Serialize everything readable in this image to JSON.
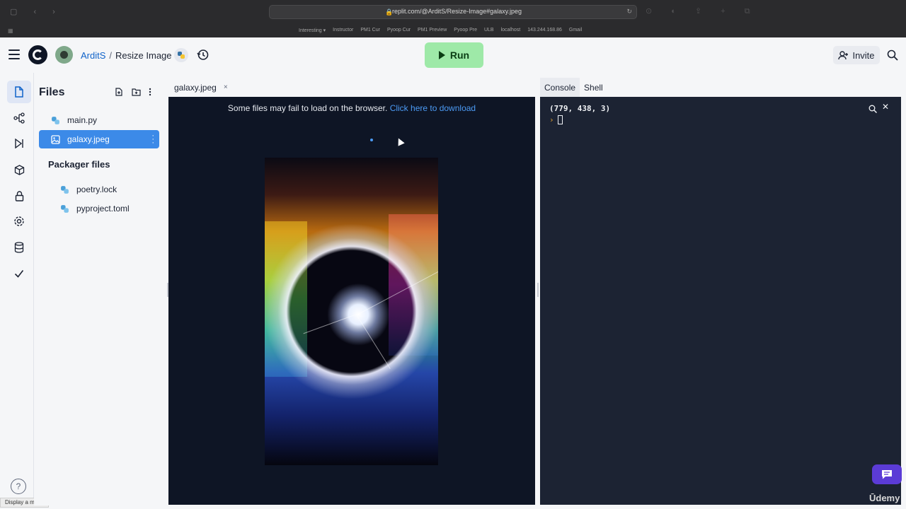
{
  "browser": {
    "url": "replit.com/@ArditS/Resize-Image#galaxy.jpeg",
    "bookmarks": [
      "Interesting ▾",
      "Instructor",
      "PM1 Cur",
      "Pyoop Cur",
      "PM1 Preview",
      "Pyoop Pre",
      "ULB",
      "localhost",
      "143.244.168.86",
      "Gmail"
    ]
  },
  "header": {
    "user": "ArditS",
    "separator": "/",
    "repl_name": "Resize Image",
    "run_label": "Run",
    "invite_label": "Invite"
  },
  "files_panel": {
    "title": "Files",
    "files": [
      {
        "name": "main.py",
        "icon": "python-icon"
      },
      {
        "name": "galaxy.jpeg",
        "icon": "image-icon",
        "selected": true
      }
    ],
    "packager_title": "Packager files",
    "packager_files": [
      {
        "name": "poetry.lock",
        "icon": "python-icon"
      },
      {
        "name": "pyproject.toml",
        "icon": "python-icon"
      }
    ]
  },
  "editor": {
    "tab_label": "galaxy.jpeg",
    "tab_close": "×",
    "notice_text": "Some files may fail to load on the browser.",
    "notice_link": "Click here to download"
  },
  "console": {
    "tabs": [
      "Console",
      "Shell"
    ],
    "active_tab": "Console",
    "output": "(779, 438, 3)",
    "prompt": "›"
  },
  "status_tip": "Display a menu",
  "watermark": "Ūdemy",
  "colors": {
    "accent": "#3c8ae8",
    "run_button": "#9ee9a8",
    "editor_bg": "#0e1525",
    "console_bg": "#1c2333",
    "chat_button": "#5b3bd6"
  }
}
